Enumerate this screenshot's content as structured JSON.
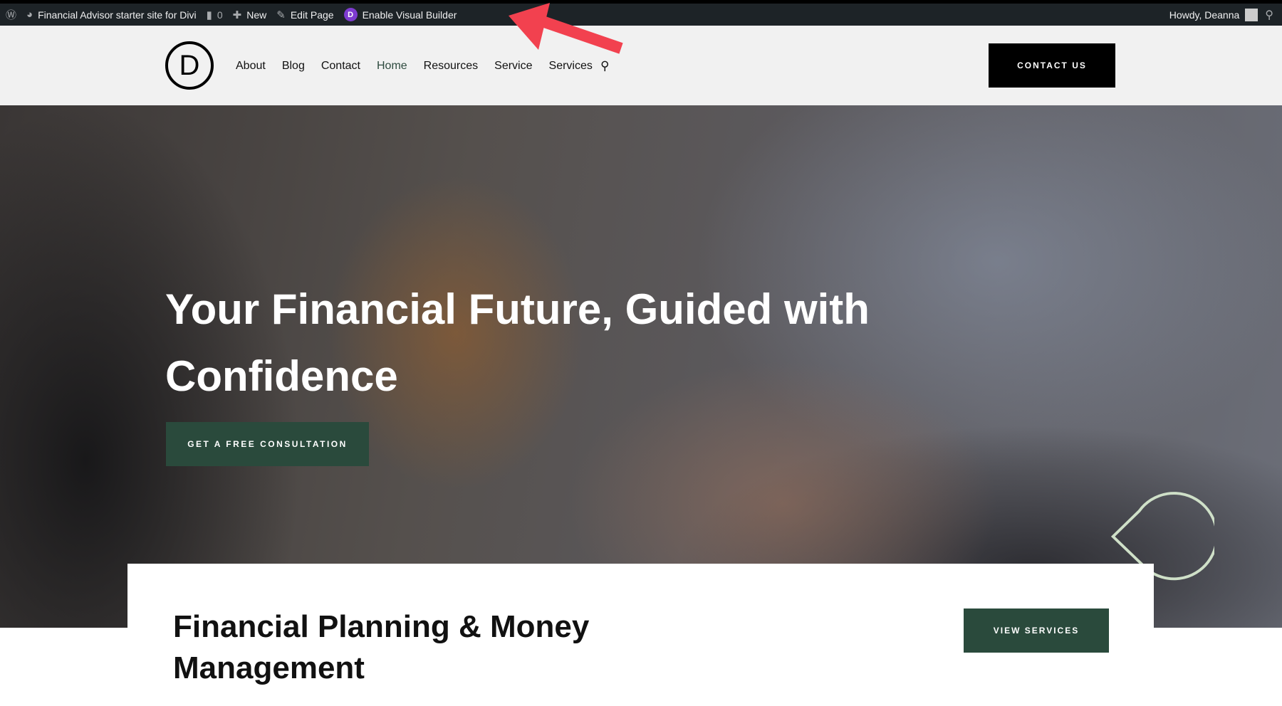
{
  "adminbar": {
    "site": "Financial Advisor starter site for Divi",
    "comments": "0",
    "new": "New",
    "edit": "Edit Page",
    "visual_builder": "Enable Visual Builder",
    "divi_letter": "D",
    "howdy": "Howdy, Deanna"
  },
  "header": {
    "logo_letter": "D",
    "nav": [
      "About",
      "Blog",
      "Contact",
      "Home",
      "Resources",
      "Service",
      "Services"
    ],
    "active": "Home",
    "contact": "CONTACT US"
  },
  "hero": {
    "title": "Your Financial Future, Guided with Confidence",
    "cta": "GET A FREE CONSULTATION"
  },
  "section": {
    "title": "Financial Planning & Money Management",
    "button": "VIEW SERVICES"
  },
  "colors": {
    "accent": "#2a4a3c",
    "adminbar": "#1d2327",
    "annotation_arrow": "#f2414f"
  }
}
